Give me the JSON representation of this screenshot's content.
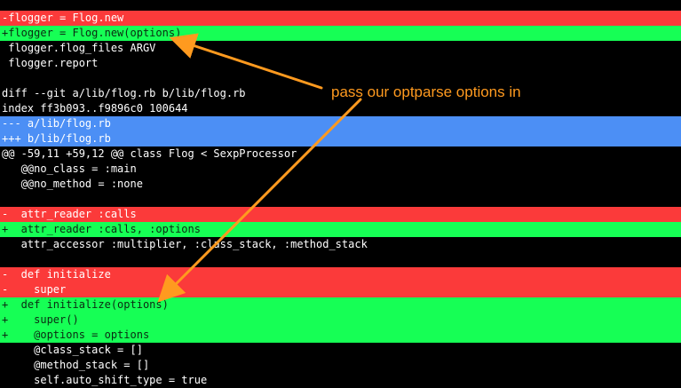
{
  "diff": {
    "lines": [
      {
        "kind": "del",
        "text": "-flogger = Flog.new"
      },
      {
        "kind": "add",
        "text": "+flogger = Flog.new(options)"
      },
      {
        "kind": "ctx",
        "text": " flogger.flog_files ARGV"
      },
      {
        "kind": "ctx",
        "text": " flogger.report"
      },
      {
        "kind": "blank",
        "text": ""
      },
      {
        "kind": "meta",
        "text": "diff --git a/lib/flog.rb b/lib/flog.rb"
      },
      {
        "kind": "meta",
        "text": "index ff3b093..f9896c0 100644"
      },
      {
        "kind": "hdr",
        "text": "--- a/lib/flog.rb"
      },
      {
        "kind": "hdr",
        "text": "+++ b/lib/flog.rb"
      },
      {
        "kind": "meta",
        "text": "@@ -59,11 +59,12 @@ class Flog < SexpProcessor"
      },
      {
        "kind": "ctx",
        "text": "   @@no_class = :main"
      },
      {
        "kind": "ctx",
        "text": "   @@no_method = :none"
      },
      {
        "kind": "blank",
        "text": ""
      },
      {
        "kind": "del",
        "text": "-  attr_reader :calls"
      },
      {
        "kind": "add",
        "text": "+  attr_reader :calls, :options"
      },
      {
        "kind": "ctx",
        "text": "   attr_accessor :multiplier, :class_stack, :method_stack"
      },
      {
        "kind": "blank",
        "text": ""
      },
      {
        "kind": "del",
        "text": "-  def initialize"
      },
      {
        "kind": "del",
        "text": "-    super"
      },
      {
        "kind": "add",
        "text": "+  def initialize(options)"
      },
      {
        "kind": "add",
        "text": "+    super()"
      },
      {
        "kind": "add",
        "text": "+    @options = options"
      },
      {
        "kind": "ctx",
        "text": "     @class_stack = []"
      },
      {
        "kind": "ctx",
        "text": "     @method_stack = []"
      },
      {
        "kind": "ctx",
        "text": "     self.auto_shift_type = true"
      }
    ]
  },
  "annotation": {
    "text": "pass our optparse options in",
    "color": "#ff9a1f"
  },
  "colors": {
    "background": "#000000",
    "deleted": "#fb3a3a",
    "added": "#16ff55",
    "file_header": "#4c8ff5"
  }
}
